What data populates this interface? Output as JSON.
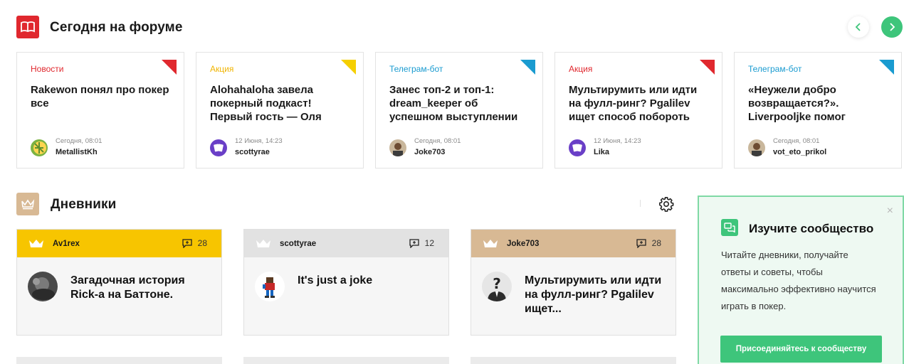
{
  "forum": {
    "title": "Сегодня на форуме",
    "cards": [
      {
        "category": "Новости",
        "category_color": "#e0282e",
        "corner_color": "#e0282e",
        "title": "Rakewon понял про покер все",
        "date": "Сегодня, 08:01",
        "author": "MetallistKh",
        "avatar": "green-yellow-badge-avatar"
      },
      {
        "category": "Акция",
        "category_color": "#f0b400",
        "corner_color": "#f5cf00",
        "title": "Alohahaloha завела покерный подкаст! Первый гость — Оля",
        "date": "12 Июня, 14:23",
        "author": "scottyrae",
        "avatar": "purple-cards-avatar"
      },
      {
        "category": "Телеграм-бот",
        "category_color": "#1a9bd0",
        "corner_color": "#1a9bd0",
        "title": "Занес топ-2 и топ-1: dream_keeper об успешном выступлении",
        "date": "Сегодня, 08:01",
        "author": "Joke703",
        "avatar": "photo-avatar"
      },
      {
        "category": "Акция",
        "category_color": "#e0282e",
        "corner_color": "#e0282e",
        "title": "Мультирумить или идти на фулл-ринг? Pgalilev ищет способ побороть",
        "date": "12 Июня, 14:23",
        "author": "Lika",
        "avatar": "purple-cards-avatar"
      },
      {
        "category": "Телеграм-бот",
        "category_color": "#1a9bd0",
        "corner_color": "#1a9bd0",
        "title": "«Неужели добро возвращается?». Liverpooljke помог",
        "date": "Сегодня, 08:01",
        "author": "vot_eto_prikol",
        "avatar": "photo-avatar"
      }
    ]
  },
  "diaries": {
    "title": "Дневники",
    "cards": [
      {
        "author": "Av1rex",
        "comments": "28",
        "header_color": "#f7c500",
        "title": "Загадочная история Rick-a на Баттоне.",
        "avatar": "dark-photo-avatar"
      },
      {
        "author": "scottyrae",
        "comments": "12",
        "header_color": "#e2e2e2",
        "title": "It's just a joke",
        "avatar": "pixel-character-avatar"
      },
      {
        "author": "Joke703",
        "comments": "28",
        "header_color": "#d8b994",
        "title": "Мультирумить или идти на фулл-ринг? Pgalilev ищет...",
        "avatar": "question-mark-avatar"
      }
    ]
  },
  "community": {
    "title": "Изучите сообщество",
    "text": "Читайте дневники, получайте ответы и советы, чтобы максимально эффективно научится играть в покер.",
    "button": "Присоединяйтесь к сообществу",
    "close": "×"
  }
}
